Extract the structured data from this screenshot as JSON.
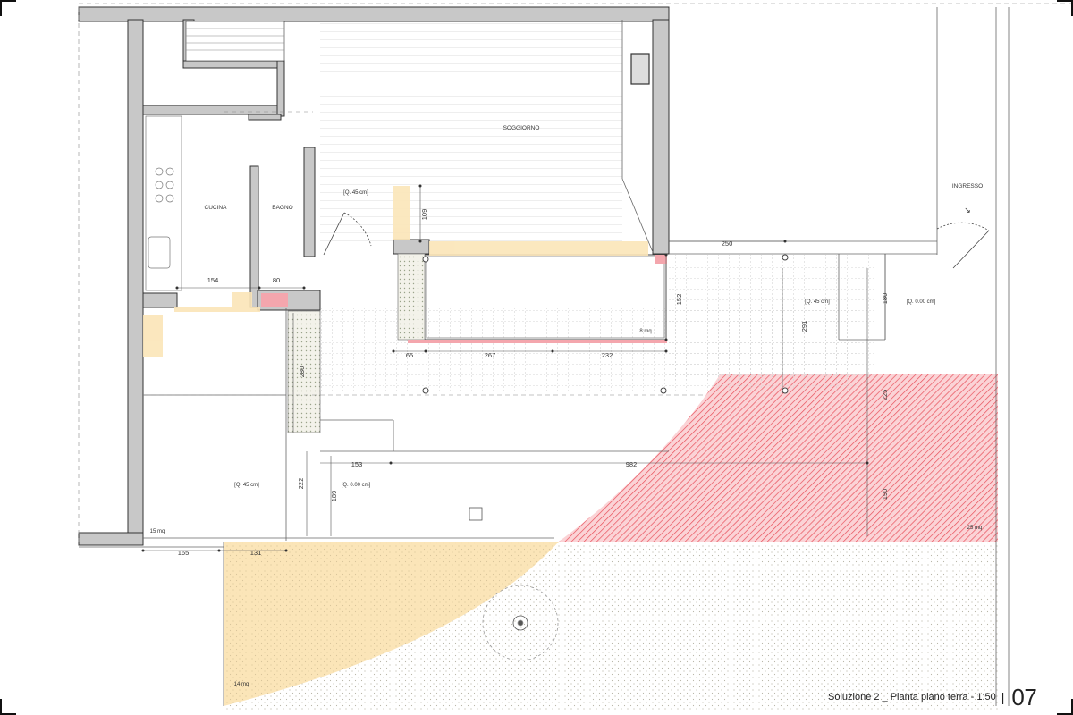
{
  "sheet": {
    "caption": "Soluzione 2 _ Pianta piano terra - 1:50",
    "separator": "|",
    "number": "07"
  },
  "rooms": {
    "soggiorno": "SOGGIORNO",
    "cucina": "CUCINA",
    "bagno": "BAGNO",
    "ingresso": "INGRESSO"
  },
  "levels": {
    "l1": "[Q. 45 cm]",
    "l2": "[Q. 45 cm]",
    "l3": "[Q. 0.00 cm]",
    "l4": "[Q. 45 cm]",
    "l5": "[Q. 0.00 cm]"
  },
  "areas": {
    "a1": "8 mq",
    "a2": "15 mq",
    "a3": "25 mq",
    "a4": "14 mq"
  },
  "dimensions": {
    "d154": "154",
    "d80": "80",
    "d109": "109",
    "d250": "250",
    "d152": "152",
    "d180": "180",
    "d291": "291",
    "d65": "65",
    "d267": "267",
    "d232": "232",
    "d280": "280",
    "d225": "225",
    "d153": "153",
    "d982": "982",
    "d222": "222",
    "d189": "189",
    "d190": "190",
    "d165": "165",
    "d131": "131"
  },
  "colors": {
    "wall": "#c8c8c8",
    "wall_stroke": "#333333",
    "red_hatch": "#e8505b",
    "yellow_area": "#fbe5b8",
    "line": "#777777"
  }
}
